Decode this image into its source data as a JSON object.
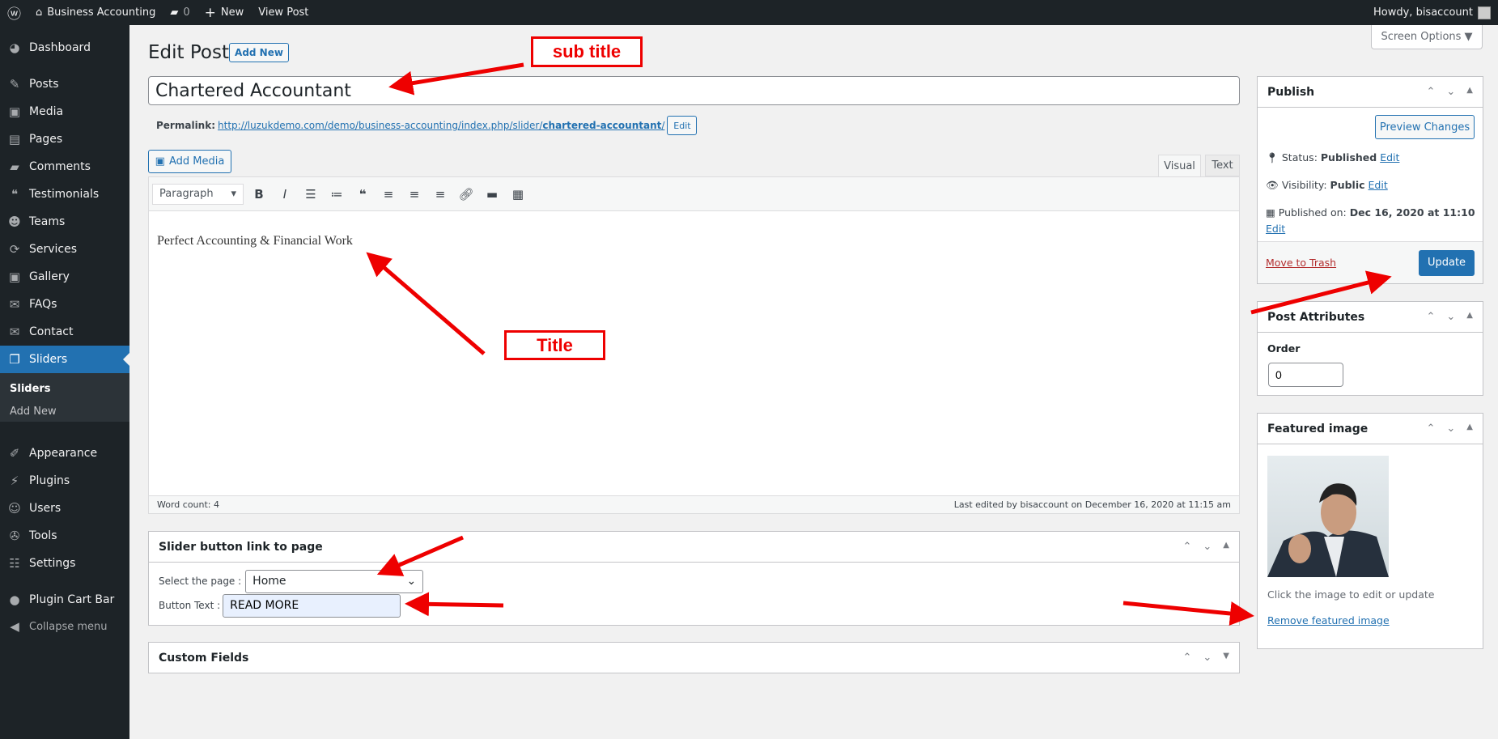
{
  "adminbar": {
    "site": "Business Accounting",
    "comments": "0",
    "new": "New",
    "view": "View Post",
    "howdy": "Howdy, bisaccount"
  },
  "sidebar": {
    "items": [
      {
        "label": "Dashboard",
        "icon": "dashboard-icon",
        "g": "◕"
      },
      {
        "label": "Posts",
        "icon": "pin-icon",
        "g": "✎"
      },
      {
        "label": "Media",
        "icon": "media-icon",
        "g": "▣"
      },
      {
        "label": "Pages",
        "icon": "pages-icon",
        "g": "▤"
      },
      {
        "label": "Comments",
        "icon": "comment-icon",
        "g": "▰"
      },
      {
        "label": "Testimonials",
        "icon": "testimonial-icon",
        "g": "❝"
      },
      {
        "label": "Teams",
        "icon": "groups-icon",
        "g": "☻"
      },
      {
        "label": "Services",
        "icon": "update-icon",
        "g": "⟳"
      },
      {
        "label": "Gallery",
        "icon": "gallery-icon",
        "g": "▣"
      },
      {
        "label": "FAQs",
        "icon": "chat-icon",
        "g": "✉"
      },
      {
        "label": "Contact",
        "icon": "email-icon",
        "g": "✉"
      },
      {
        "label": "Sliders",
        "icon": "slides-icon",
        "g": "❐"
      },
      {
        "label": "Appearance",
        "icon": "brush-icon",
        "g": "✐"
      },
      {
        "label": "Plugins",
        "icon": "plugin-icon",
        "g": "⚡"
      },
      {
        "label": "Users",
        "icon": "user-icon",
        "g": "☺"
      },
      {
        "label": "Tools",
        "icon": "wrench-icon",
        "g": "✇"
      },
      {
        "label": "Settings",
        "icon": "settings-icon",
        "g": "☷"
      },
      {
        "label": "Plugin Cart Bar",
        "icon": "plugin-cart-bar-icon",
        "g": "●"
      },
      {
        "label": "Collapse menu",
        "icon": "collapse-icon",
        "g": "◀"
      }
    ],
    "submenu": [
      "Sliders",
      "Add New"
    ]
  },
  "header": {
    "title": "Edit Post",
    "add_new": "Add New",
    "screen_options": "Screen Options ▼"
  },
  "post": {
    "title": "Chartered Accountant",
    "permalink_label": "Permalink:",
    "permalink_base": "http://luzukdemo.com/demo/business-accounting/index.php/slider/",
    "permalink_slug": "chartered-accountant",
    "permalink_end": "/",
    "edit": "Edit"
  },
  "editor": {
    "add_media": "Add Media",
    "tab_visual": "Visual",
    "tab_text": "Text",
    "format": "Paragraph",
    "content": "Perfect Accounting & Financial Work",
    "word_count": "Word count: 4",
    "last_edited": "Last edited by bisaccount on December 16, 2020 at 11:15 am"
  },
  "slider_box": {
    "title": "Slider button link to page",
    "select_label": "Select the page :",
    "select_value": "Home",
    "button_label": "Button Text :",
    "button_value": "READ MORE"
  },
  "custom_fields": {
    "title": "Custom Fields"
  },
  "publish": {
    "title": "Publish",
    "preview": "Preview Changes",
    "status_label": "Status:",
    "status": "Published",
    "visibility_label": "Visibility:",
    "visibility": "Public",
    "published_label": "Published on:",
    "published": "Dec 16, 2020 at 11:10",
    "edit": "Edit",
    "trash": "Move to Trash",
    "update": "Update"
  },
  "attributes": {
    "title": "Post Attributes",
    "order_label": "Order",
    "order": "0"
  },
  "featured": {
    "title": "Featured image",
    "hint": "Click the image to edit or update",
    "remove": "Remove featured image"
  },
  "annotations": {
    "subtitle": "sub title",
    "title": "Title",
    "color": "#ee0000"
  }
}
